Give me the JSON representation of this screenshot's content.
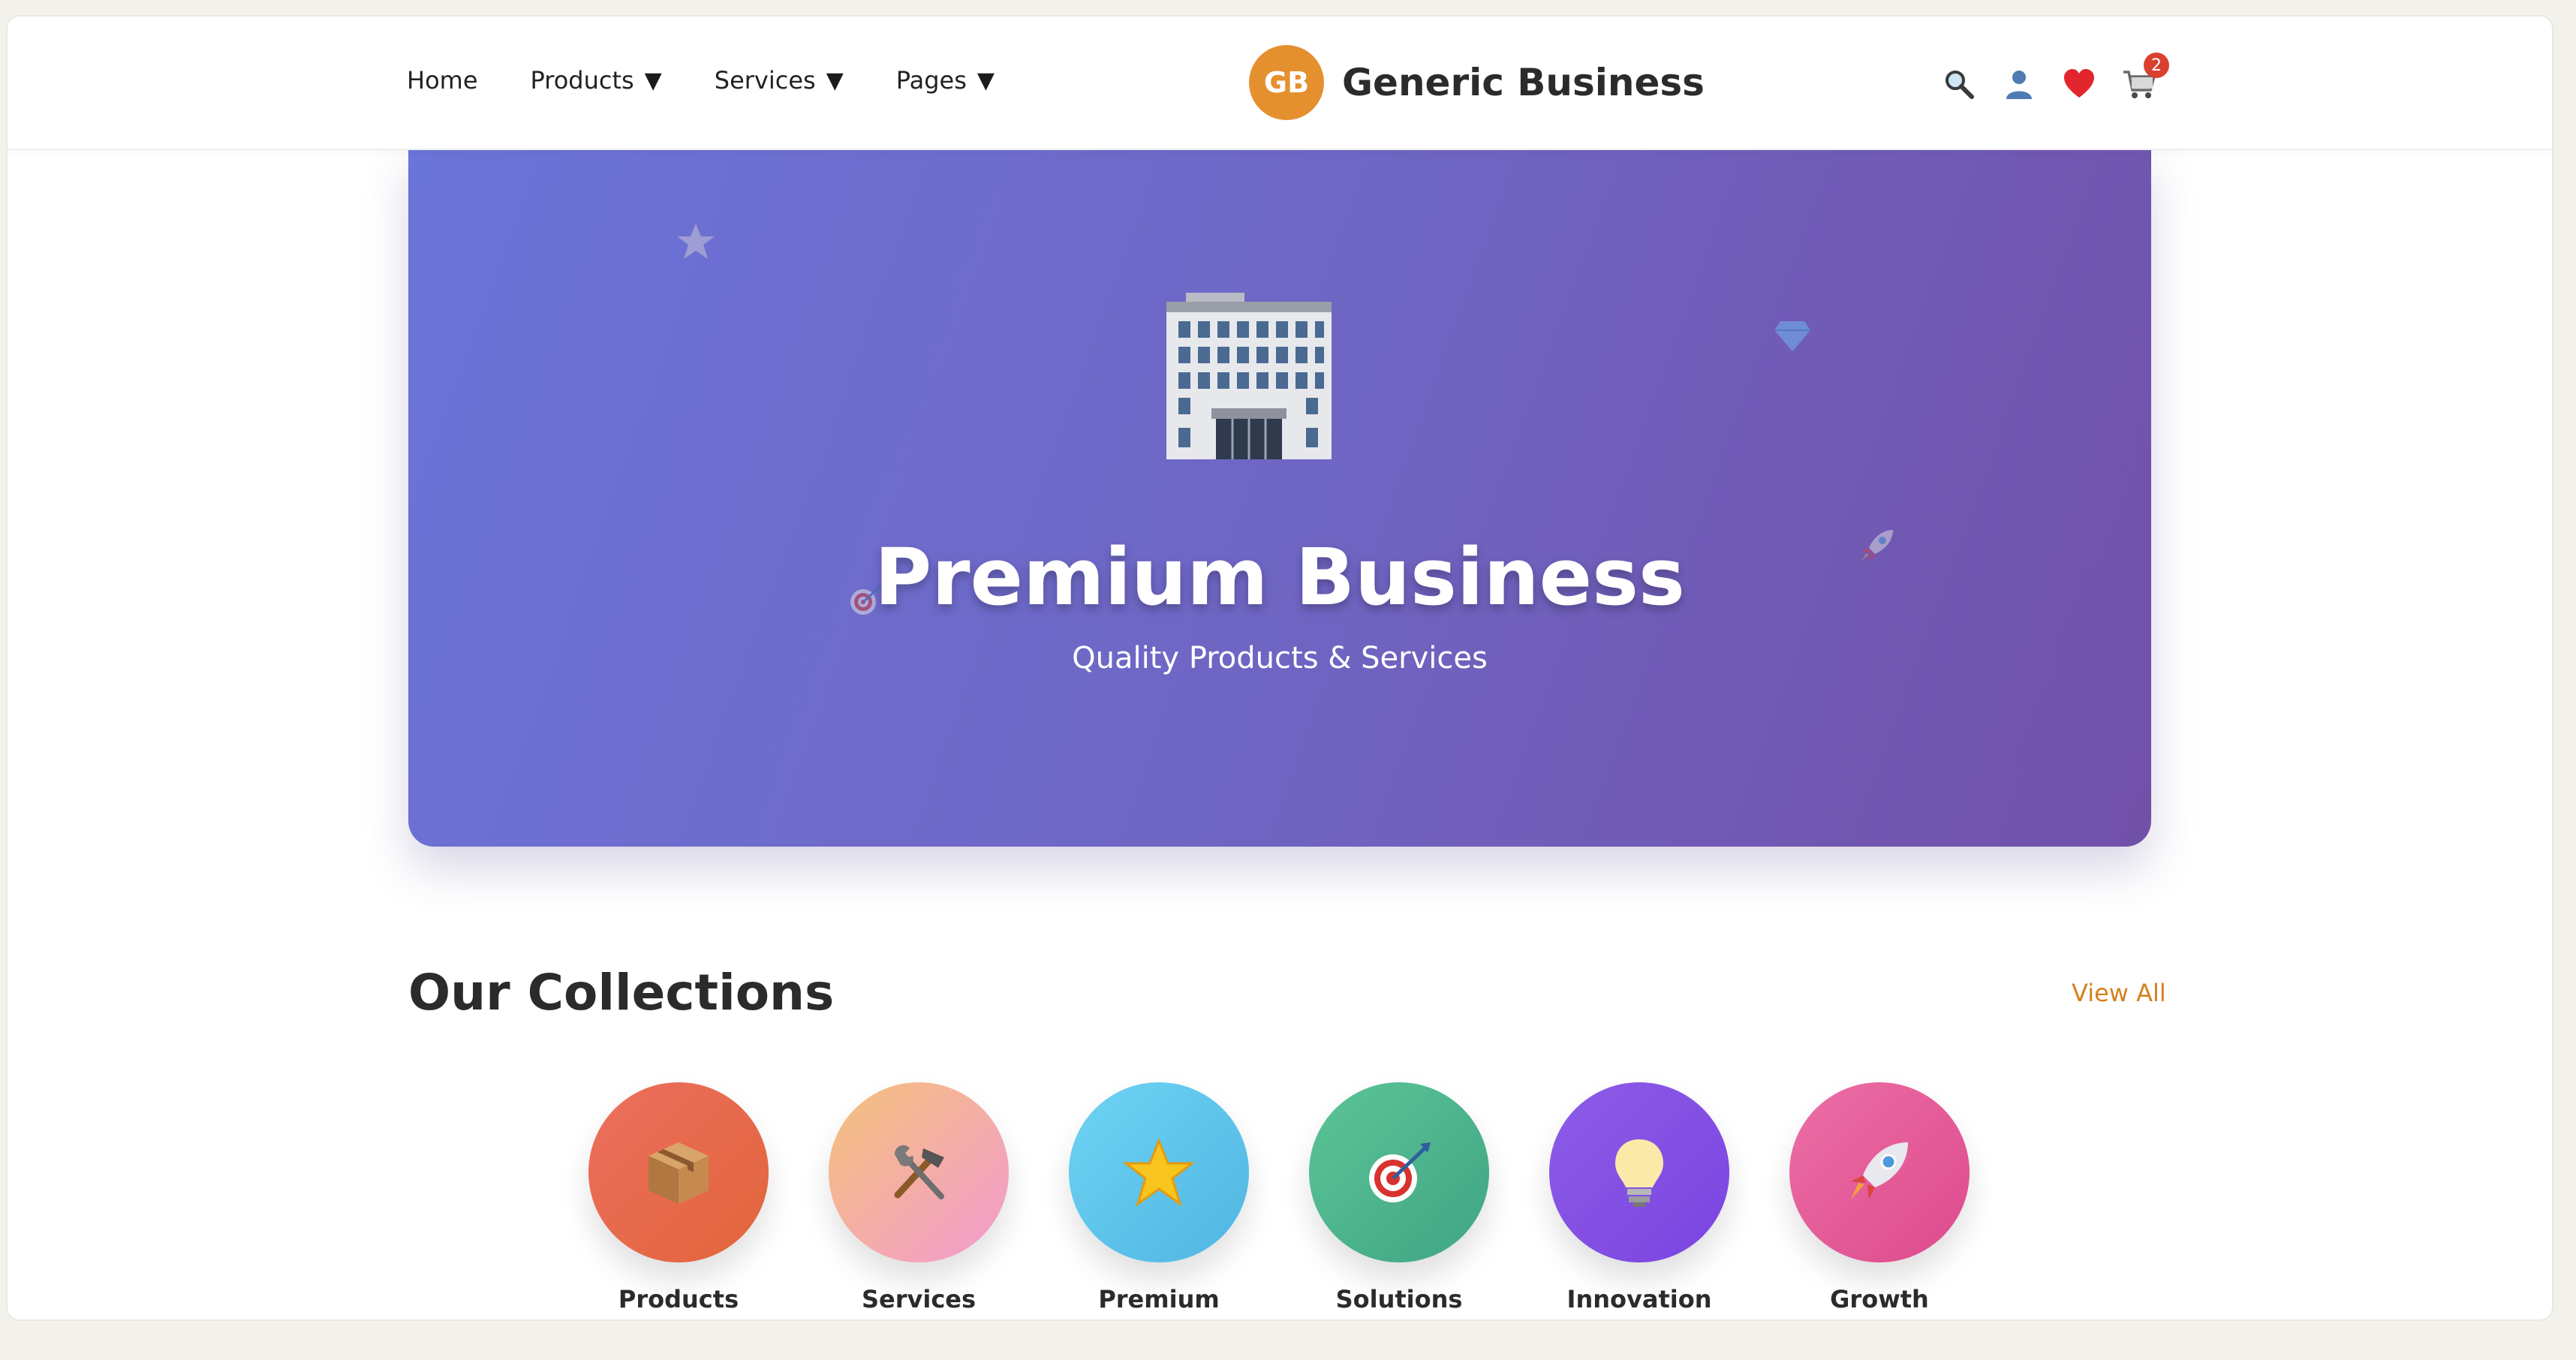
{
  "nav": {
    "items": [
      {
        "label": "Home",
        "dropdown": false
      },
      {
        "label": "Products",
        "dropdown": true
      },
      {
        "label": "Services",
        "dropdown": true
      },
      {
        "label": "Pages",
        "dropdown": true
      }
    ],
    "caret": "▼"
  },
  "brand": {
    "logo_initials": "GB",
    "name": "Generic Business",
    "logo_color": "#e5902f"
  },
  "header_icons": {
    "items": [
      "search-icon",
      "user-icon",
      "heart-icon",
      "cart-icon"
    ],
    "cart_count": "2"
  },
  "hero": {
    "title": "Premium Business",
    "subtitle": "Quality Products & Services",
    "main_icon": "building-icon",
    "decorative_icons": [
      "star-icon",
      "gem-icon",
      "rocket-icon",
      "target-icon"
    ],
    "gradient": [
      "#6b74d8",
      "#7150a8"
    ]
  },
  "collections": {
    "title": "Our Collections",
    "view_all": "View All",
    "accent": "#d6801f",
    "items": [
      {
        "label": "Products",
        "icon": "package-icon"
      },
      {
        "label": "Services",
        "icon": "tools-icon"
      },
      {
        "label": "Premium",
        "icon": "star-icon"
      },
      {
        "label": "Solutions",
        "icon": "target-icon"
      },
      {
        "label": "Innovation",
        "icon": "lightbulb-icon"
      },
      {
        "label": "Growth",
        "icon": "rocket-icon"
      }
    ]
  }
}
